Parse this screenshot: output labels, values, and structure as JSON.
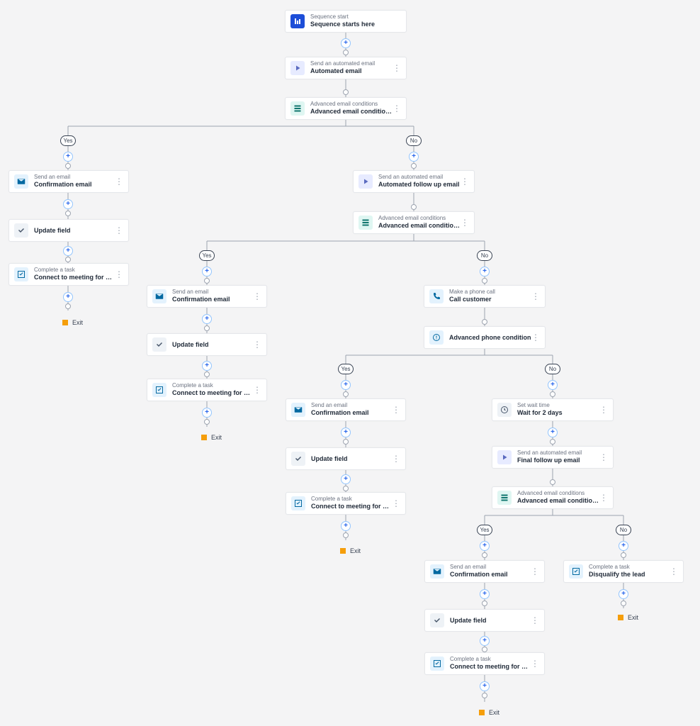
{
  "labels": {
    "yes": "Yes",
    "no": "No",
    "exit": "Exit"
  },
  "types": {
    "seq_start": "Sequence start",
    "auto_email": "Send an automated email",
    "adv_email_cond": "Advanced email conditions",
    "send_email": "Send an email",
    "update_field": "Update field",
    "complete_task": "Complete a task",
    "phone_call": "Make a phone call",
    "adv_phone_cond": "Advanced phone condition",
    "set_wait": "Set wait time"
  },
  "titles": {
    "seq_start": "Sequence starts here",
    "auto_email": "Automated email",
    "adv_email_cond": "Advanced email conditions",
    "confirm": "Confirmation email",
    "update_field": "Update field",
    "demo_task": "Connect to meeting for product demo r...",
    "follow_auto": "Automated follow up email",
    "call_cust": "Call customer",
    "adv_phone_cond": "Advanced phone condition",
    "wait2": "Wait for 2 days",
    "final_follow": "Final follow up email",
    "disqualify": "Disqualify the lead"
  }
}
